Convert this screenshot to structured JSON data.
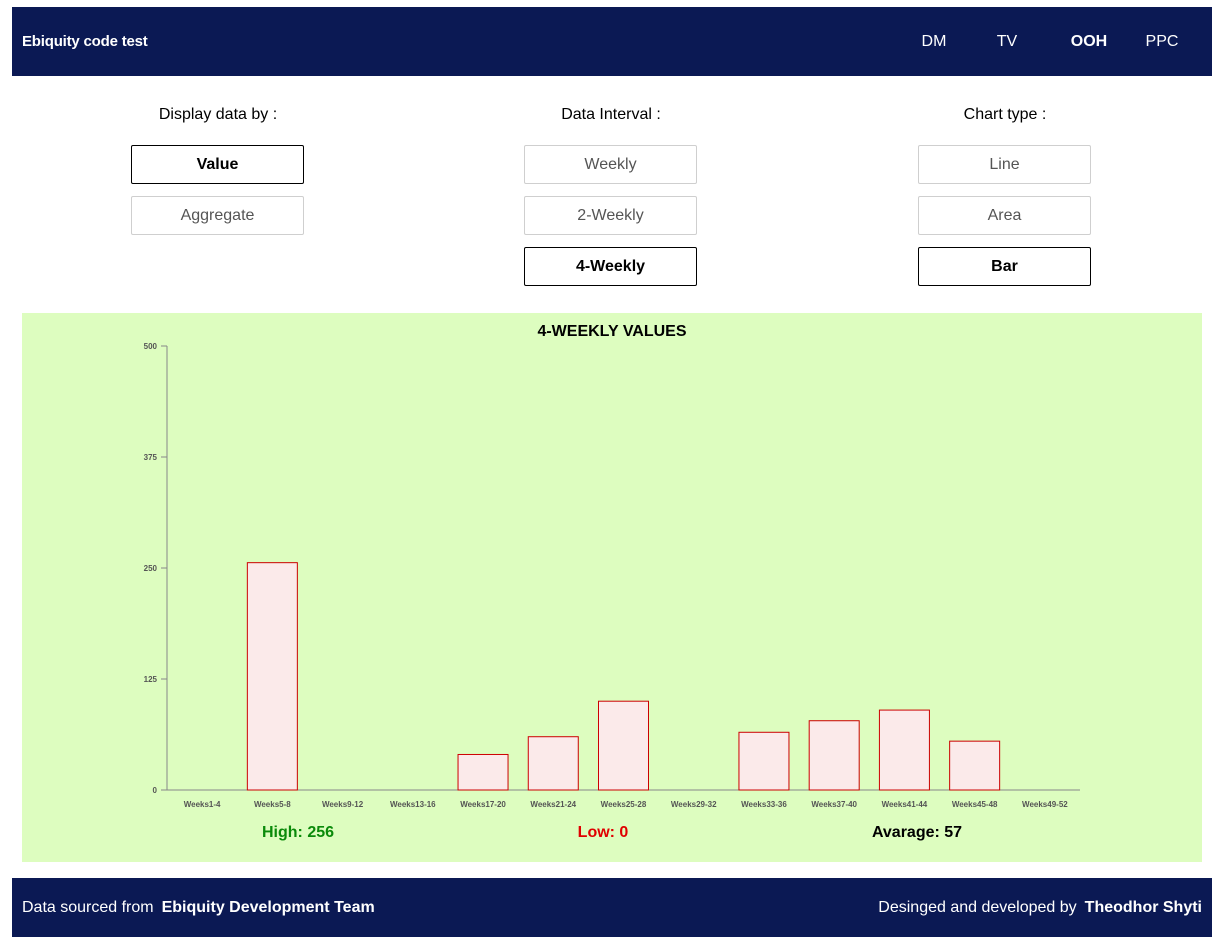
{
  "header": {
    "title": "Ebiquity code test",
    "nav": [
      {
        "label": "DM",
        "active": false
      },
      {
        "label": "TV",
        "active": false
      },
      {
        "label": "OOH",
        "active": true
      },
      {
        "label": "PPC",
        "active": false
      }
    ]
  },
  "controls": {
    "display": {
      "label": "Display data by :",
      "options": [
        {
          "label": "Value",
          "selected": true
        },
        {
          "label": "Aggregate",
          "selected": false
        }
      ]
    },
    "interval": {
      "label": "Data Interval :",
      "options": [
        {
          "label": "Weekly",
          "selected": false
        },
        {
          "label": "2-Weekly",
          "selected": false
        },
        {
          "label": "4-Weekly",
          "selected": true
        }
      ]
    },
    "chart_type": {
      "label": "Chart type :",
      "options": [
        {
          "label": "Line",
          "selected": false
        },
        {
          "label": "Area",
          "selected": false
        },
        {
          "label": "Bar",
          "selected": true
        }
      ]
    }
  },
  "chart_data": {
    "type": "bar",
    "title": "4-WEEKLY VALUES",
    "xlabel": "",
    "ylabel": "",
    "ylim": [
      0,
      500
    ],
    "yticks": [
      0,
      125,
      250,
      375,
      500
    ],
    "categories": [
      "Weeks1-4",
      "Weeks5-8",
      "Weeks9-12",
      "Weeks13-16",
      "Weeks17-20",
      "Weeks21-24",
      "Weeks25-28",
      "Weeks29-32",
      "Weeks33-36",
      "Weeks37-40",
      "Weeks41-44",
      "Weeks45-48",
      "Weeks49-52"
    ],
    "values": [
      0,
      256,
      0,
      0,
      40,
      60,
      100,
      0,
      65,
      78,
      90,
      55,
      0
    ],
    "grid": false,
    "bar_fill": "#fbeaea",
    "bar_stroke": "#cc0000"
  },
  "stats": {
    "high": "High: 256",
    "low": "Low: 0",
    "average": "Avarage: 57"
  },
  "footer": {
    "source_prefix": "Data sourced from",
    "source_name": "Ebiquity Development Team",
    "credit_prefix": "Desinged and developed by",
    "credit_name": "Theodhor Shyti"
  }
}
